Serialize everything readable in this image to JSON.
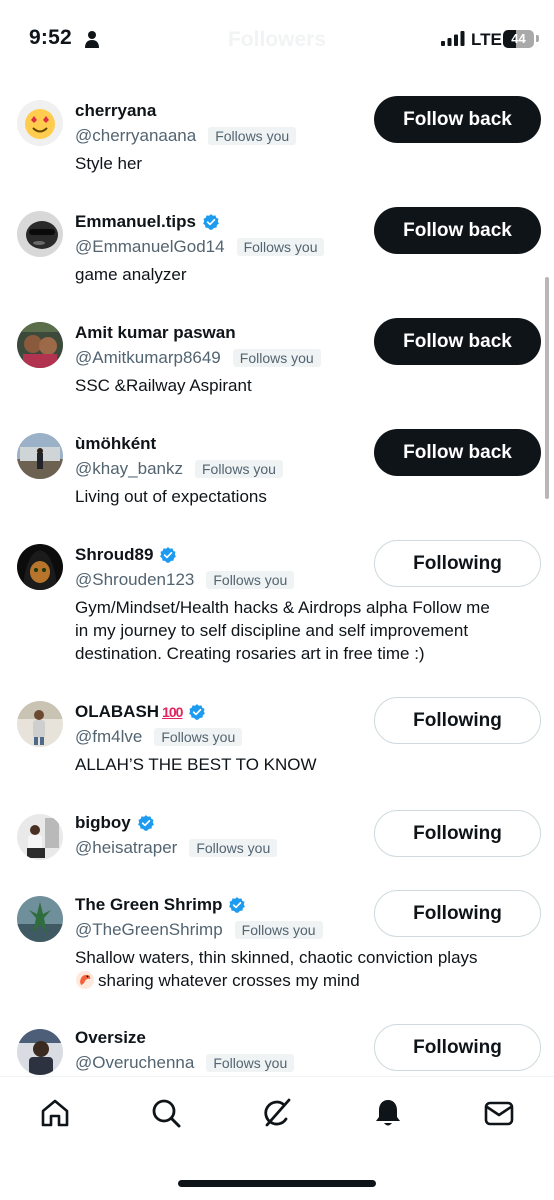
{
  "status_bar": {
    "time": "9:52",
    "network": "LTE",
    "battery": "44"
  },
  "header": {
    "title": "Followers"
  },
  "followers": [
    {
      "name": "cherryana",
      "handle": "@cherryanaana",
      "badge": "Follows you",
      "bio": "Style her",
      "button": "Follow back",
      "verified": false
    },
    {
      "name": "Emmanuel.tips",
      "handle": "@EmmanuelGod14",
      "badge": "Follows you",
      "bio": "game analyzer",
      "button": "Follow back",
      "verified": true
    },
    {
      "name": "Amit kumar paswan",
      "handle": "@Amitkumarp8649",
      "badge": "Follows you",
      "bio": "SSC &Railway Aspirant",
      "button": "Follow back",
      "verified": false
    },
    {
      "name": "ùmöhként",
      "handle": "@khay_bankz",
      "badge": "Follows you",
      "bio": "Living out of expectations",
      "button": "Follow back",
      "verified": false
    },
    {
      "name": "Shroud89",
      "handle": "@Shrouden123",
      "badge": "Follows you",
      "bio_lines": [
        "Gym/Mindset/Health hacks & Airdrops alpha Follow me",
        "in my journey to self discipline and self improvement",
        "destination. Creating rosaries art in free time :)"
      ],
      "button": "Following",
      "verified": true
    },
    {
      "name": "OLABASH",
      "name_emoji": "100",
      "handle": "@fm4lve",
      "badge": "Follows you",
      "bio": "ALLAH’S THE BEST TO KNOW",
      "button": "Following",
      "verified": true
    },
    {
      "name": "bigboy",
      "handle": "@heisatraper",
      "badge": "Follows you",
      "bio": "",
      "button": "Following",
      "verified": true
    },
    {
      "name": "The Green Shrimp",
      "handle": "@TheGreenShrimp",
      "badge": "Follows you",
      "bio_lines": [
        "Shallow waters, thin skinned, chaotic conviction plays",
        "sharing whatever crosses my mind"
      ],
      "bio_emoji_icon": "shrimp-icon",
      "button": "Following",
      "verified": true
    },
    {
      "name": "Oversize",
      "handle": "@Overuchenna",
      "badge": "Follows you",
      "bio": "",
      "button": "Following",
      "verified": false
    }
  ],
  "nav": {
    "items": [
      "home-icon",
      "search-icon",
      "grok-icon",
      "notifications-icon",
      "messages-icon"
    ]
  },
  "colors": {
    "primary_text": "#0f1419",
    "secondary_text": "#536471",
    "verified": "#1d9bf0",
    "dark_button": "#0f1419"
  }
}
